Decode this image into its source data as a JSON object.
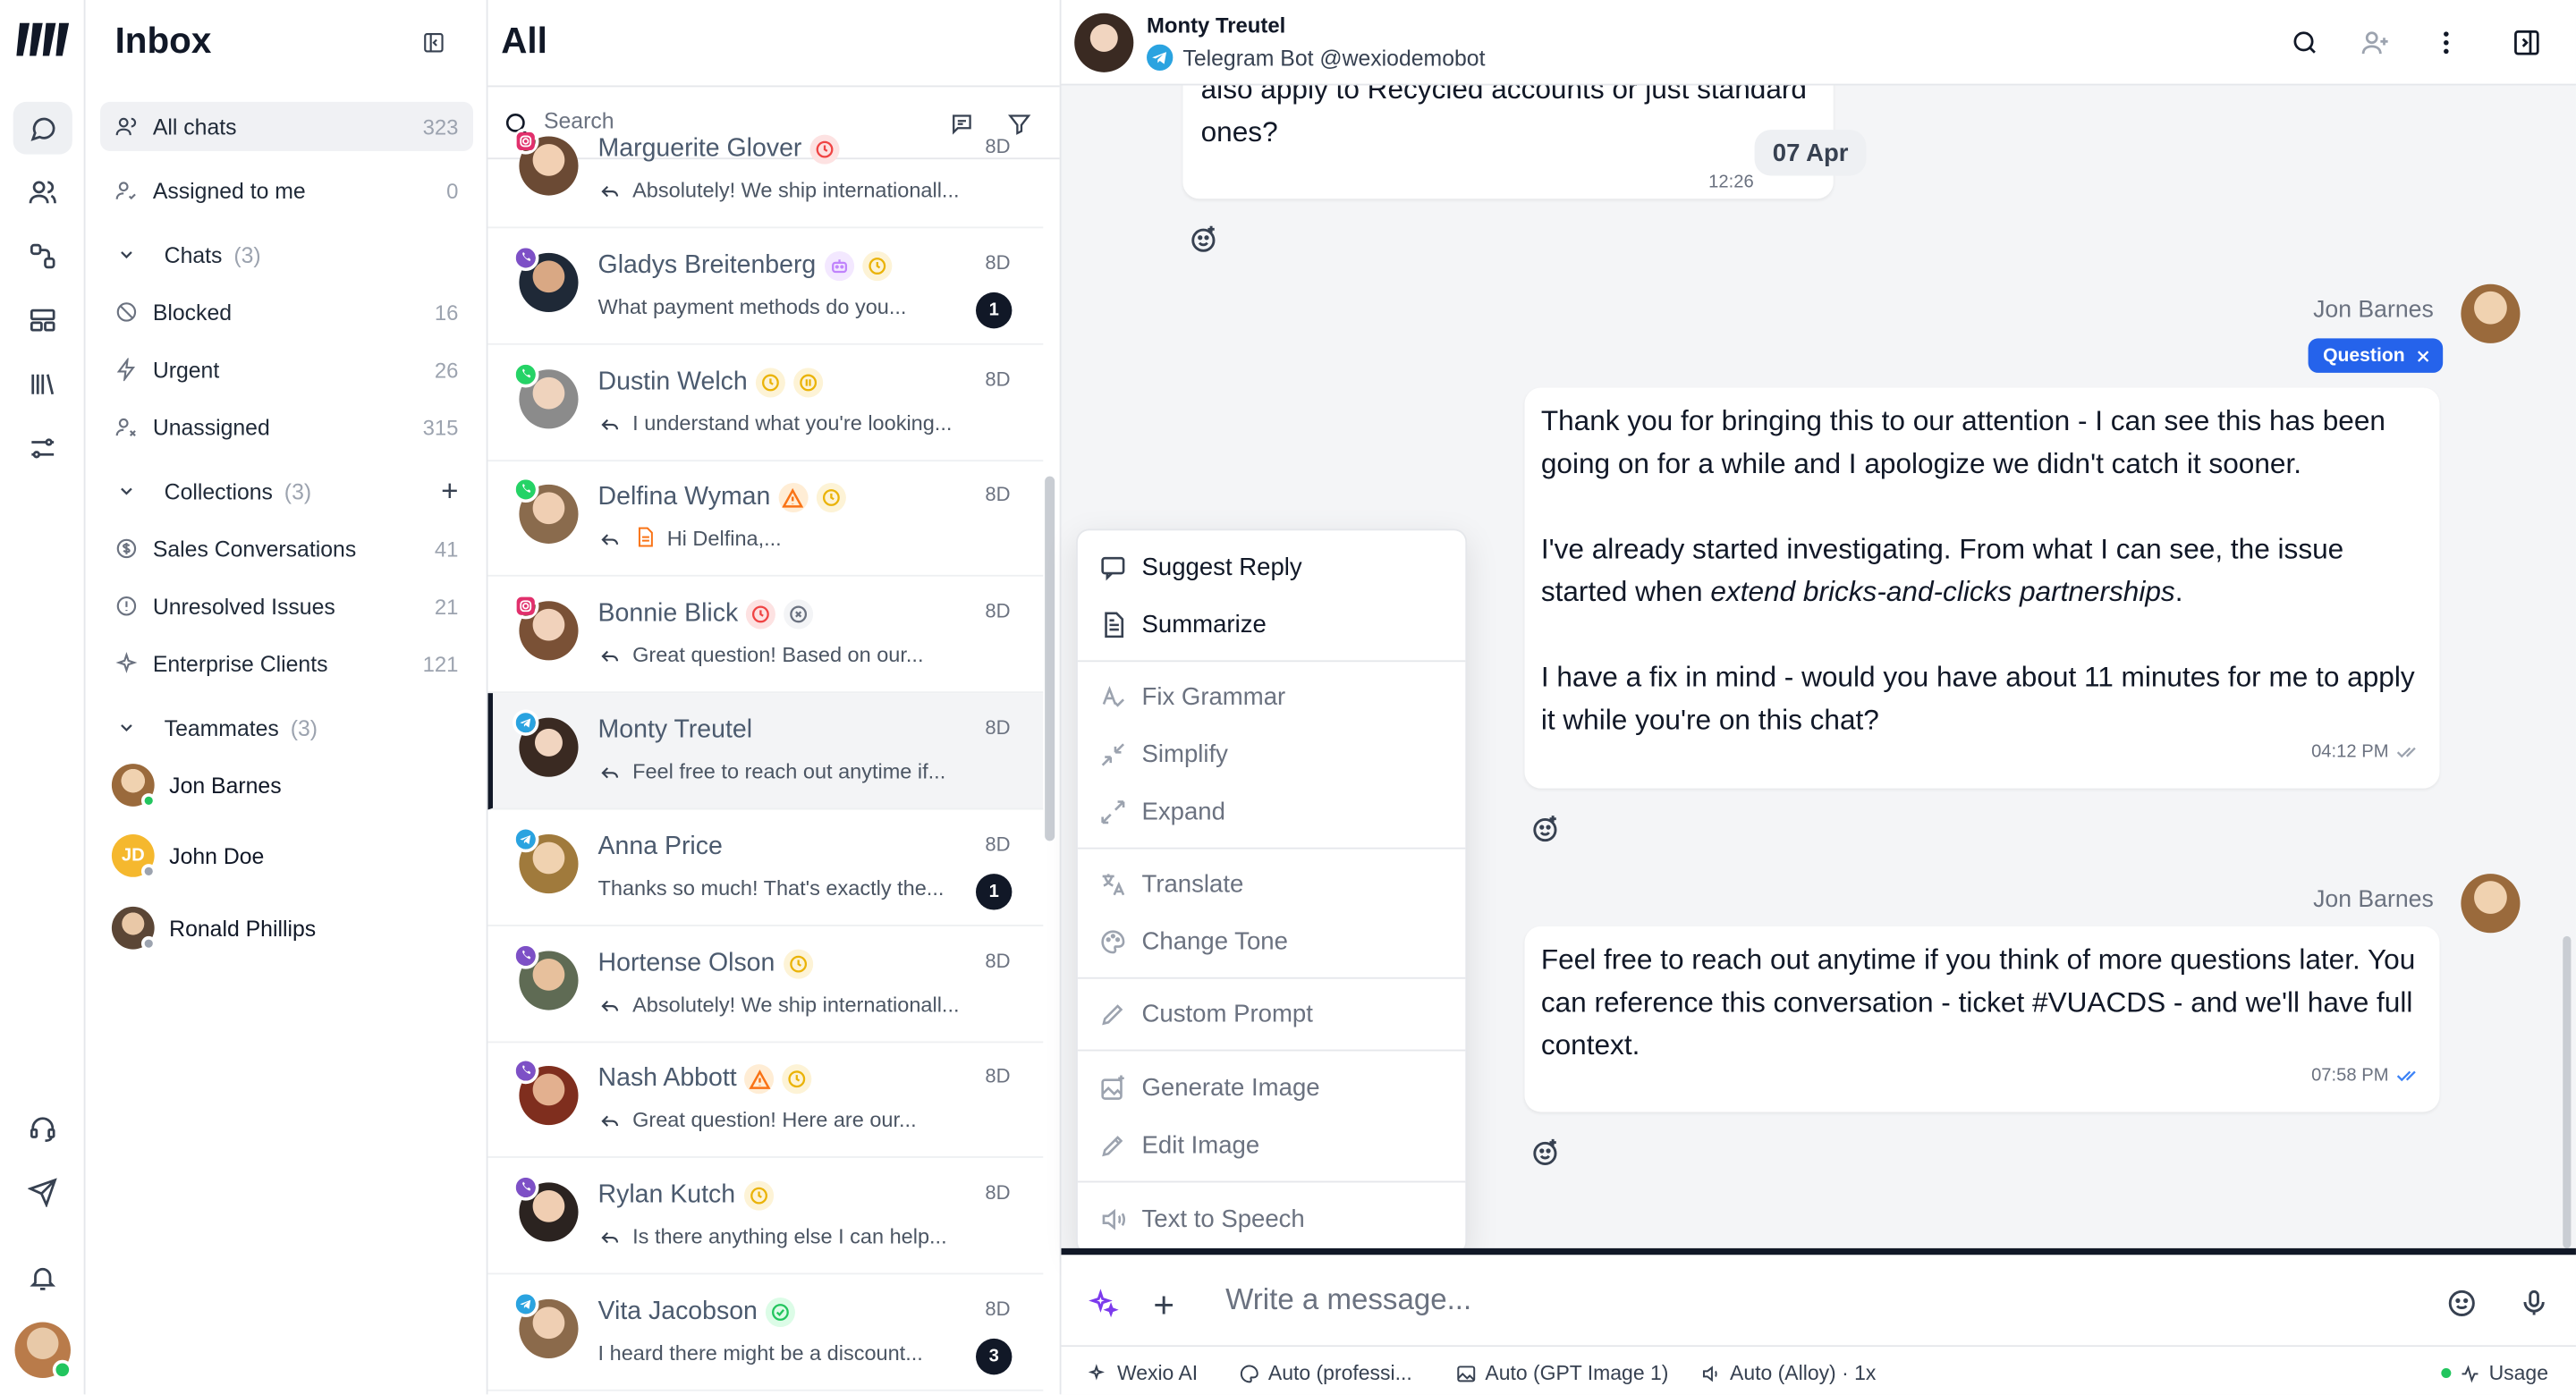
{
  "sidebar": {
    "title": "Inbox",
    "items": [
      {
        "label": "All chats",
        "count": "323"
      },
      {
        "label": "Assigned to me",
        "count": "0"
      },
      {
        "label": "Chats",
        "count": "(3)"
      },
      {
        "label": "Blocked",
        "count": "16"
      },
      {
        "label": "Urgent",
        "count": "26"
      },
      {
        "label": "Unassigned",
        "count": "315"
      },
      {
        "label": "Collections",
        "count": "(3)"
      },
      {
        "label": "Sales Conversations",
        "count": "41"
      },
      {
        "label": "Unresolved Issues",
        "count": "21"
      },
      {
        "label": "Enterprise Clients",
        "count": "121"
      },
      {
        "label": "Teammates",
        "count": "(3)"
      }
    ],
    "teammates": [
      {
        "name": "Jon Barnes",
        "status": "online"
      },
      {
        "name": "John Doe",
        "initials": "JD",
        "status": "offline"
      },
      {
        "name": "Ronald Phillips",
        "status": "offline"
      }
    ]
  },
  "list": {
    "title": "All",
    "search_placeholder": "Search",
    "chats": [
      {
        "name": "Marguerite Glover",
        "channel": "instagram",
        "time": "8D",
        "preview": "Absolutely! We ship internationall...",
        "replied": true,
        "badges": [
          "clock-red"
        ]
      },
      {
        "name": "Gladys Breitenberg",
        "channel": "viber",
        "time": "8D",
        "preview": "What payment methods do you...",
        "replied": false,
        "unread": "1",
        "badges": [
          "bot",
          "clock"
        ]
      },
      {
        "name": "Dustin Welch",
        "channel": "whatsapp",
        "time": "8D",
        "preview": "I understand what you're looking...",
        "replied": true,
        "badges": [
          "clock",
          "hold"
        ]
      },
      {
        "name": "Delfina Wyman",
        "channel": "whatsapp",
        "time": "8D",
        "preview": "Hi Delfina,...",
        "replied": true,
        "doc": true,
        "badges": [
          "warn",
          "clock"
        ]
      },
      {
        "name": "Bonnie Blick",
        "channel": "instagram",
        "time": "8D",
        "preview": "Great question! Based on our...",
        "replied": true,
        "badges": [
          "clock-red",
          "blocked"
        ]
      },
      {
        "name": "Monty Treutel",
        "channel": "telegram",
        "time": "8D",
        "preview": "Feel free to reach out anytime if...",
        "replied": true,
        "selected": true,
        "badges": []
      },
      {
        "name": "Anna Price",
        "channel": "telegram",
        "time": "8D",
        "preview": "Thanks so much! That's exactly the...",
        "replied": false,
        "unread": "1",
        "badges": []
      },
      {
        "name": "Hortense Olson",
        "channel": "viber",
        "time": "8D",
        "preview": "Absolutely! We ship internationall...",
        "replied": true,
        "badges": [
          "clock"
        ]
      },
      {
        "name": "Nash Abbott",
        "channel": "viber",
        "time": "8D",
        "preview": "Great question! Here are our...",
        "replied": true,
        "badges": [
          "warn",
          "clock"
        ]
      },
      {
        "name": "Rylan Kutch",
        "channel": "viber",
        "time": "8D",
        "preview": "Is there anything else I can help...",
        "replied": true,
        "badges": [
          "clock"
        ]
      },
      {
        "name": "Vita Jacobson",
        "channel": "telegram",
        "time": "8D",
        "preview": "I heard there might be a discount...",
        "replied": false,
        "unread": "3",
        "badges": [
          "check-green"
        ]
      }
    ]
  },
  "conversation": {
    "contact_name": "Monty Treutel",
    "contact_sub": "Telegram Bot @wexiodemobot",
    "first_bubble": {
      "text_1": "also apply to Recycled accounts or just standard",
      "text_2": "ones?",
      "time": "12:26",
      "date": "07 Apr"
    },
    "msg1": {
      "sender": "Jon Barnes",
      "tag": "Question",
      "p1": "Thank you for bringing this to our attention - I can see this has been going on for a while and I apologize we didn't catch it sooner.",
      "p2a": "I've already started investigating. From what I can see, the issue started when ",
      "p2b": "extend bricks-and-clicks partnerships",
      "p2c": ".",
      "p3": "I have a fix in mind - would you have about 11 minutes for me to apply it while you're on this chat?",
      "time": "04:12 PM"
    },
    "msg2": {
      "sender": "Jon Barnes",
      "p1": "Feel free to reach out anytime if you think of more questions later. You can reference this conversation - ticket #VUACDS - and we'll have full context.",
      "time": "07:58 PM"
    }
  },
  "ai_menu": {
    "items": [
      "Suggest Reply",
      "Summarize",
      "Fix Grammar",
      "Simplify",
      "Expand",
      "Translate",
      "Change Tone",
      "Custom Prompt",
      "Generate Image",
      "Edit Image",
      "Text to Speech"
    ]
  },
  "composer": {
    "placeholder": "Write a message...",
    "bottom": {
      "ai": "Wexio AI",
      "tone": "Auto (professi...",
      "image": "Auto (GPT Image 1)",
      "voice": "Auto (Alloy) · 1x",
      "usage": "Usage"
    }
  },
  "colors": {
    "accent": "#2563eb",
    "tag": "#3b82f6",
    "online": "#22c55e",
    "selected_border": "#111827"
  }
}
